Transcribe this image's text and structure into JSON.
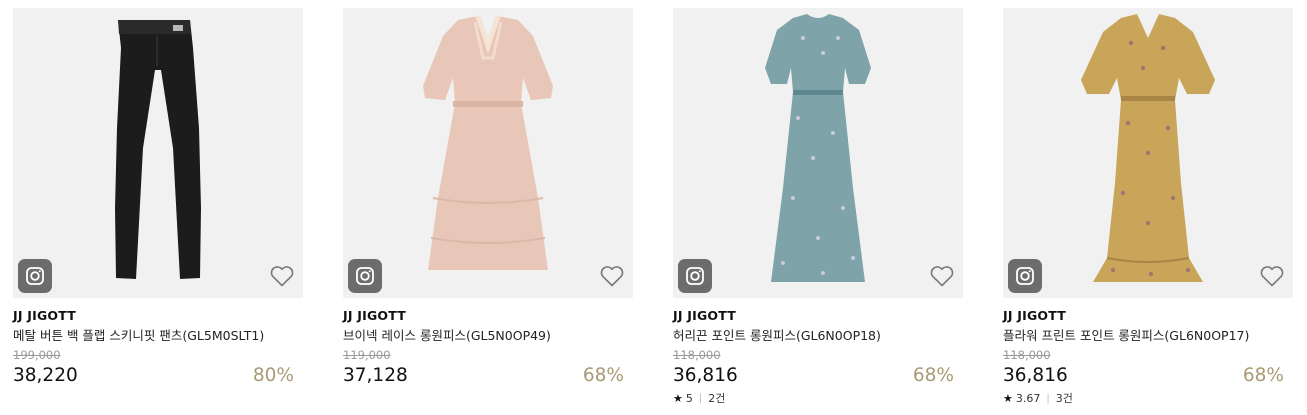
{
  "products": [
    {
      "brand": "JJ JIGOTT",
      "name": "메탈 버튼 백 플랩 스키니핏 팬츠(GL5M0SLT1)",
      "original_price": "199,000",
      "price": "38,220",
      "discount": "80%",
      "rating": null,
      "image": "black-pants",
      "image_color": "#1c1c1c"
    },
    {
      "brand": "JJ JIGOTT",
      "name": "브이넥 레이스 롱원피스(GL5N0OP49)",
      "original_price": "119,000",
      "price": "37,128",
      "discount": "68%",
      "rating": null,
      "image": "pink-lace-dress",
      "image_color": "#e8c7b8"
    },
    {
      "brand": "JJ JIGOTT",
      "name": "허리끈 포인트 롱원피스(GL6N0OP18)",
      "original_price": "118,000",
      "price": "36,816",
      "discount": "68%",
      "rating": {
        "score": "5",
        "count": "2건"
      },
      "image": "blue-floral-dress",
      "image_color": "#7ea3a8"
    },
    {
      "brand": "JJ JIGOTT",
      "name": "플라워 프린트 포인트 롱원피스(GL6N0OP17)",
      "original_price": "118,000",
      "price": "36,816",
      "discount": "68%",
      "rating": {
        "score": "3.67",
        "count": "3건"
      },
      "image": "yellow-floral-dress",
      "image_color": "#c9a55a"
    }
  ],
  "icons": {
    "instagram": "instagram-icon",
    "wishlist": "heart-icon",
    "rating": "star-icon"
  },
  "colors": {
    "discount": "#a89a74",
    "original_price": "#999999",
    "thumb_bg": "#f1f1f1"
  }
}
